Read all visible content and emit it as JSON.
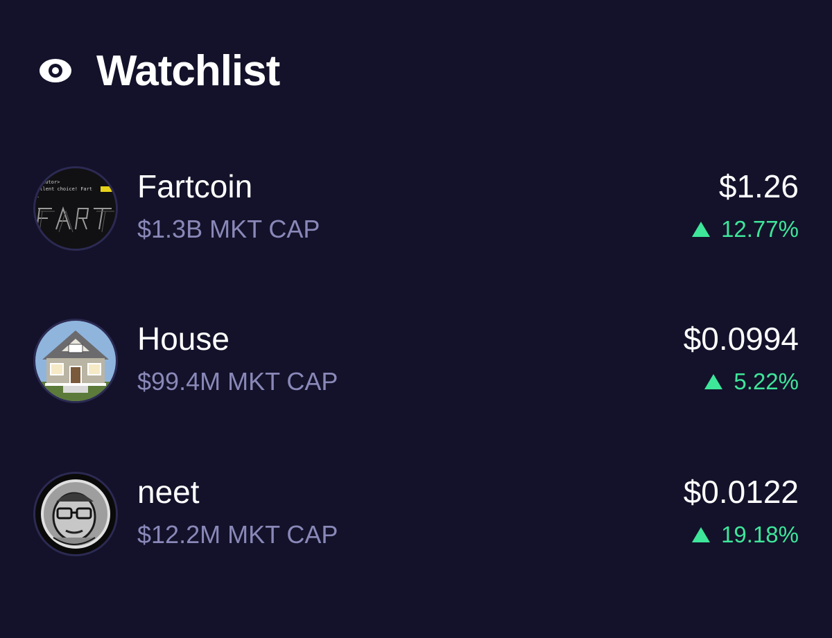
{
  "header": {
    "icon": "eye-icon",
    "title": "Watchlist"
  },
  "colors": {
    "background": "#13122a",
    "positive": "#3ee69a",
    "muted": "#8a88b8"
  },
  "watchlist": [
    {
      "name": "Fartcoin",
      "market_cap": "$1.3B MKT CAP",
      "price": "$1.26",
      "change": "12.77%",
      "direction": "up",
      "avatar": "fartcoin-logo"
    },
    {
      "name": "House",
      "market_cap": "$99.4M MKT CAP",
      "price": "$0.0994",
      "change": "5.22%",
      "direction": "up",
      "avatar": "house-logo"
    },
    {
      "name": "neet",
      "market_cap": "$12.2M MKT CAP",
      "price": "$0.0122",
      "change": "19.18%",
      "direction": "up",
      "avatar": "neet-logo"
    }
  ]
}
